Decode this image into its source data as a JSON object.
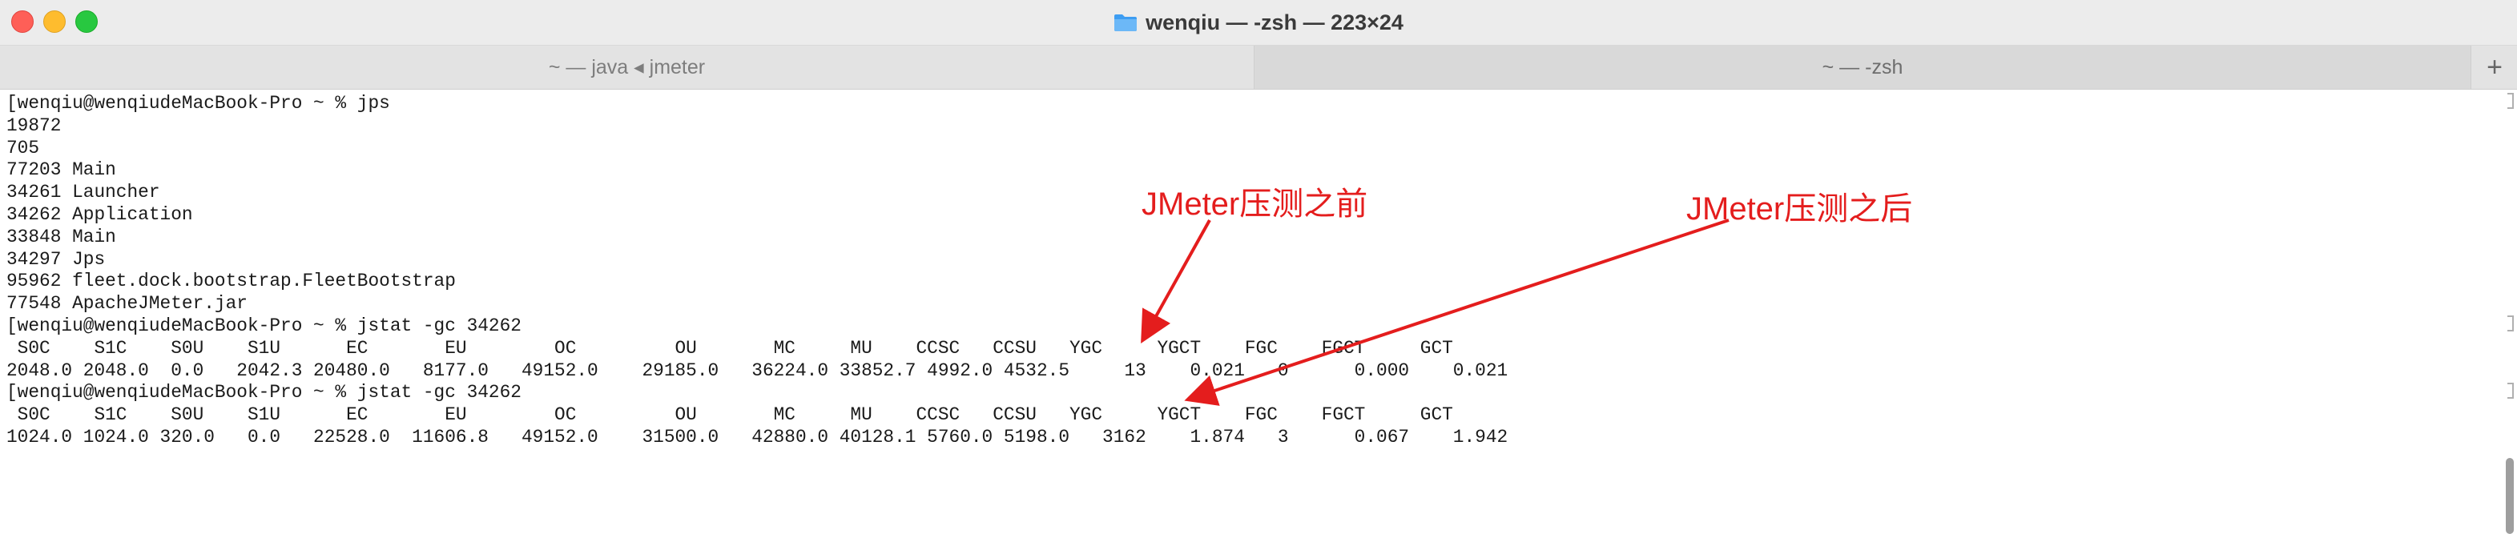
{
  "window": {
    "title": "wenqiu — -zsh — 223×24"
  },
  "tabs": [
    {
      "label": "~ — java ◂ jmeter"
    },
    {
      "label": "~ — -zsh"
    }
  ],
  "tab_add_label": "+",
  "terminal": {
    "lines": [
      "[wenqiu@wenqiudeMacBook-Pro ~ % jps",
      "19872",
      "705",
      "77203 Main",
      "34261 Launcher",
      "34262 Application",
      "33848 Main",
      "34297 Jps",
      "95962 fleet.dock.bootstrap.FleetBootstrap",
      "77548 ApacheJMeter.jar",
      "[wenqiu@wenqiudeMacBook-Pro ~ % jstat -gc 34262",
      " S0C    S1C    S0U    S1U      EC       EU        OC         OU       MC     MU    CCSC   CCSU   YGC     YGCT    FGC    FGCT     GCT",
      "2048.0 2048.0  0.0   2042.3 20480.0   8177.0   49152.0    29185.0   36224.0 33852.7 4992.0 4532.5     13    0.021   0      0.000    0.021",
      "[wenqiu@wenqiudeMacBook-Pro ~ % jstat -gc 34262",
      " S0C    S1C    S0U    S1U      EC       EU        OC         OU       MC     MU    CCSC   CCSU   YGC     YGCT    FGC    FGCT     GCT",
      "1024.0 1024.0 320.0   0.0   22528.0  11606.8   49152.0    31500.0   42880.0 40128.1 5760.0 5198.0   3162    1.874   3      0.067    1.942"
    ]
  },
  "annotations": {
    "before": "JMeter压测之前",
    "after": "JMeter压测之后",
    "color": "#e41d1d"
  },
  "colors": {
    "traffic_red": "#fe5f57",
    "traffic_yellow": "#febc2e",
    "traffic_green": "#28c840",
    "folder": "#3d9df2"
  }
}
